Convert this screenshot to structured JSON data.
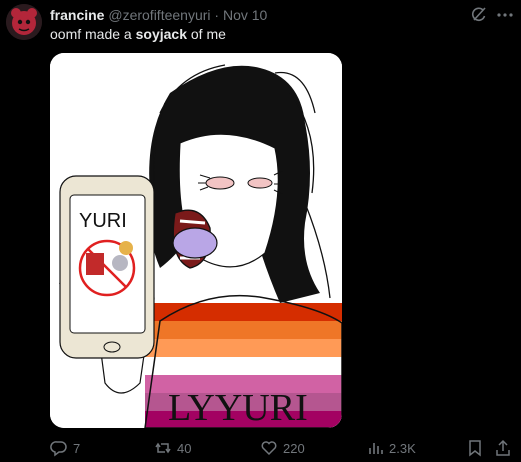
{
  "post": {
    "display_name": "francine",
    "handle": "@zerofifteenyuri",
    "separator": "·",
    "date": "Nov 10",
    "text_before": "oomf made a ",
    "text_bold": "soyjack",
    "text_after": " of me"
  },
  "media": {
    "phone_label": "YURI",
    "shirt_text": "LYYURI",
    "stripe_colors": [
      "#d52d00",
      "#ef7627",
      "#ff9a56",
      "#ffffff",
      "#d162a4",
      "#b55690",
      "#a30262"
    ]
  },
  "actions": {
    "replies": "7",
    "reposts": "40",
    "likes": "220",
    "views": "2.3K"
  },
  "icons": [
    "grok-icon",
    "more-icon",
    "reply-icon",
    "repost-icon",
    "like-icon",
    "views-icon",
    "bookmark-icon",
    "share-icon"
  ]
}
